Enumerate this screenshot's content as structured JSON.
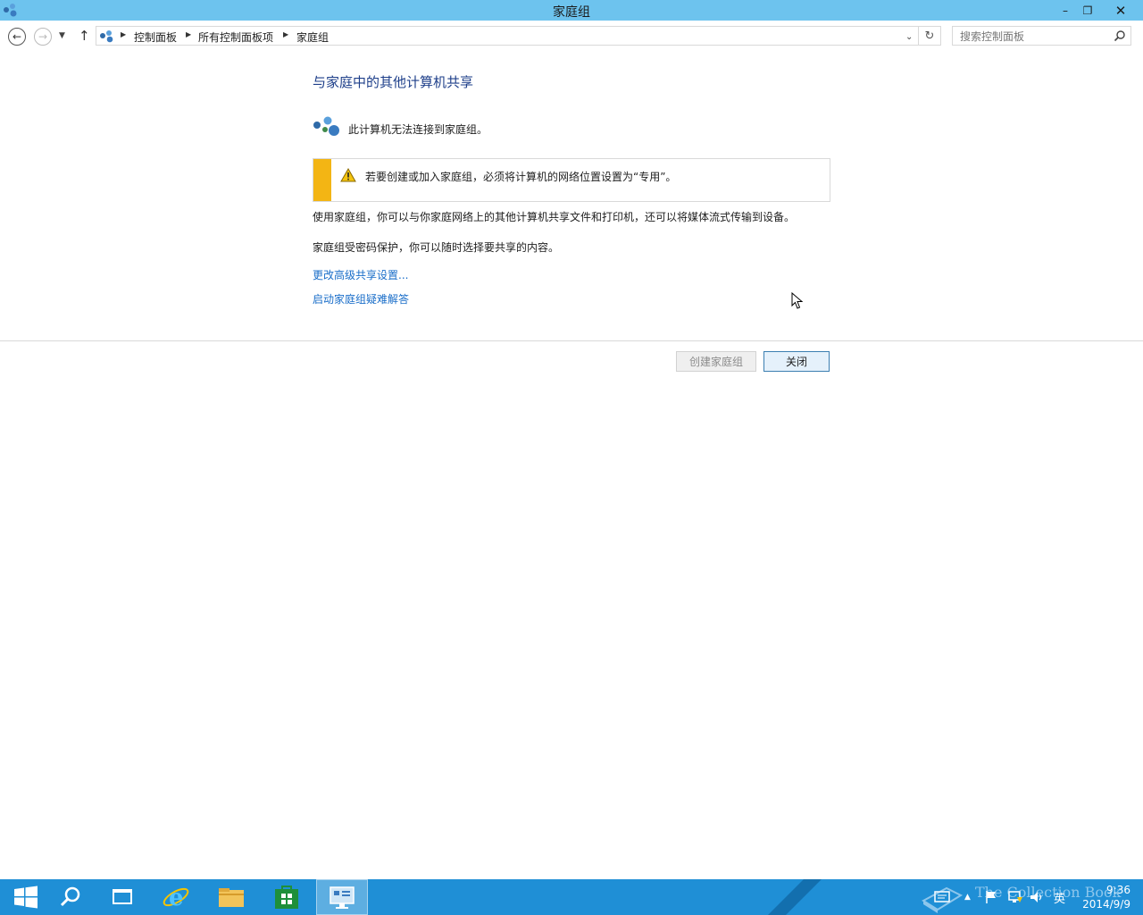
{
  "window": {
    "title": "家庭组",
    "minimize": "–",
    "maximize": "❐",
    "close": "✕"
  },
  "address_bar": {
    "breadcrumbs": [
      "控制面板",
      "所有控制面板项",
      "家庭组"
    ],
    "search_placeholder": "搜索控制面板"
  },
  "content": {
    "heading": "与家庭中的其他计算机共享",
    "status": "此计算机无法连接到家庭组。",
    "warning": "若要创建或加入家庭组，必须将计算机的网络位置设置为“专用”。",
    "description": "使用家庭组，你可以与你家庭网络上的其他计算机共享文件和打印机，还可以将媒体流式传输到设备。",
    "password_note": "家庭组受密码保护，你可以随时选择要共享的内容。",
    "links": [
      "更改高级共享设置...",
      "启动家庭组疑难解答"
    ]
  },
  "buttons": {
    "create": "创建家庭组",
    "close": "关闭"
  },
  "taskbar": {
    "clock_time": "9:36",
    "clock_date": "2014/9/9",
    "ime": "英"
  },
  "watermark": "The Collection Book",
  "colors": {
    "titlebar": "#6dc3ee",
    "taskbar": "#1f8fd6",
    "heading": "#1e3f8a",
    "link": "#1a6ec9",
    "warning_stripe": "#f3b514"
  }
}
